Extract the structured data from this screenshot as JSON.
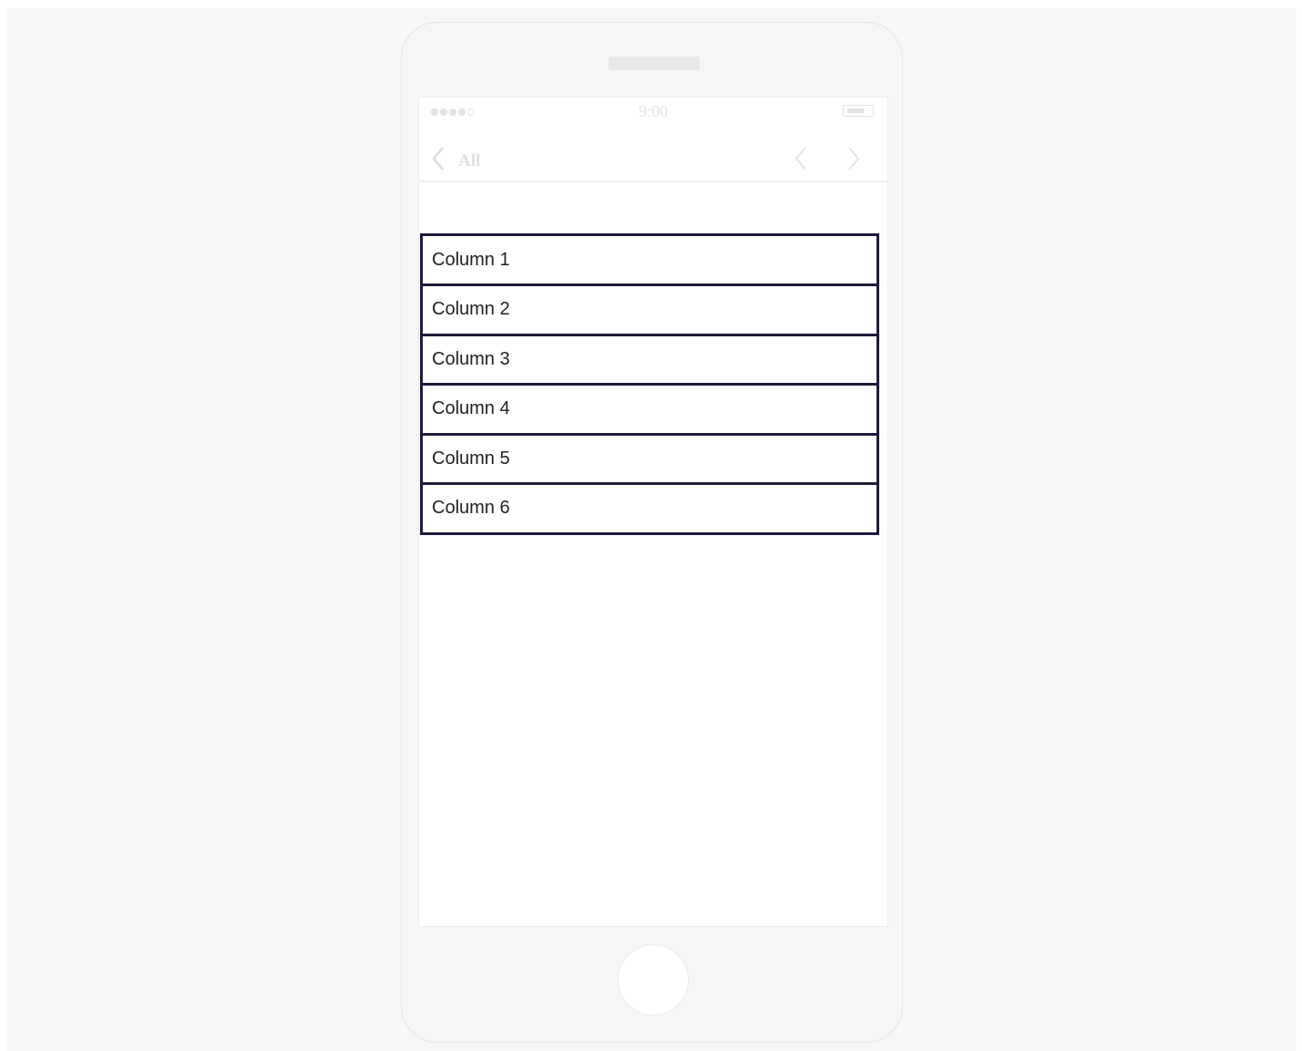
{
  "status_bar": {
    "time": "9:00",
    "signal_icon": "signal-dots-icon",
    "battery_icon": "battery-icon"
  },
  "nav_bar": {
    "back_label": "All",
    "back_icon": "chevron-left-icon",
    "prev_icon": "chevron-left-icon",
    "next_icon": "chevron-right-icon"
  },
  "list": {
    "items": [
      {
        "label": "Column 1"
      },
      {
        "label": "Column 2"
      },
      {
        "label": "Column 3"
      },
      {
        "label": "Column 4"
      },
      {
        "label": "Column 5"
      },
      {
        "label": "Column 6"
      }
    ]
  },
  "colors": {
    "list_border": "#1c1c3c",
    "device_frame": "#f6f6f6",
    "background": "#f7f7f7"
  }
}
